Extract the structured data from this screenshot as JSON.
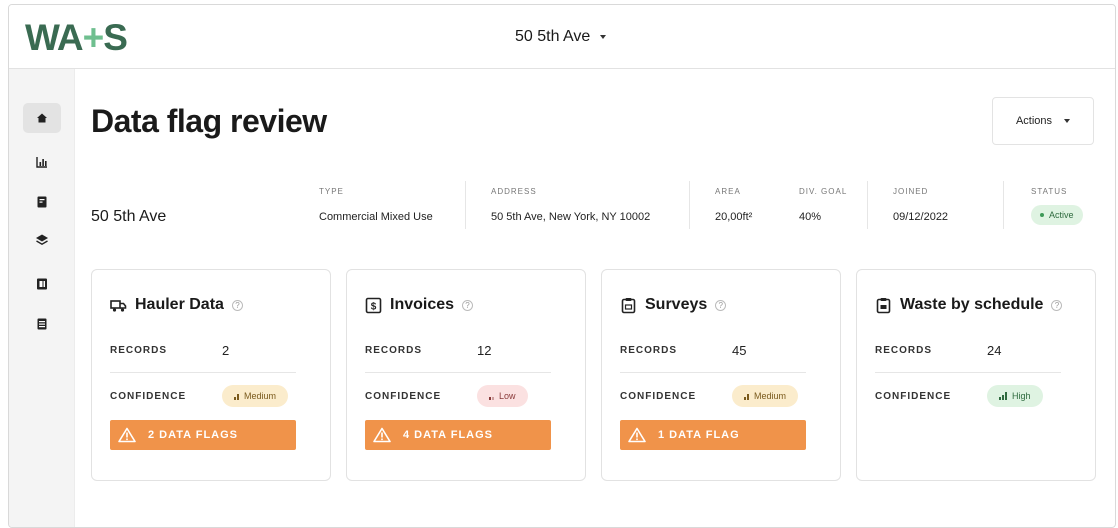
{
  "header": {
    "logo_left": "WA",
    "logo_plus": "+",
    "logo_right": "S",
    "site_selector": "50 5th Ave"
  },
  "sidebar": {
    "items": [
      {
        "icon": "home-icon",
        "active": true
      },
      {
        "icon": "chart-icon",
        "active": false
      },
      {
        "icon": "document-icon",
        "active": false
      },
      {
        "icon": "layers-icon",
        "active": false
      },
      {
        "icon": "billing-icon",
        "active": false
      },
      {
        "icon": "file-stack-icon",
        "active": false
      }
    ]
  },
  "page": {
    "title": "Data flag review",
    "actions_label": "Actions"
  },
  "site": {
    "name": "50 5th Ave",
    "meta": [
      {
        "label": "Type",
        "value": "Commercial Mixed Use"
      },
      {
        "label": "Address",
        "value": "50 5th Ave, New York, NY 10002"
      },
      {
        "label": "Area",
        "value": "20,00ft²"
      },
      {
        "label": "Div. goal",
        "value": "40%"
      },
      {
        "label": "Joined",
        "value": "09/12/2022"
      },
      {
        "label": "Status",
        "value": "Active"
      }
    ]
  },
  "cards": [
    {
      "title": "Hauler Data",
      "icon": "truck-icon",
      "records_label": "RECORDS",
      "records": "2",
      "confidence_label": "CONFIDENCE",
      "confidence": "Medium",
      "flags": "2 DATA FLAGS"
    },
    {
      "title": "Invoices",
      "icon": "invoice-icon",
      "records_label": "RECORDS",
      "records": "12",
      "confidence_label": "CONFIDENCE",
      "confidence": "Low",
      "flags": "4 DATA FLAGS"
    },
    {
      "title": "Surveys",
      "icon": "clipboard-icon",
      "records_label": "RECORDS",
      "records": "45",
      "confidence_label": "CONFIDENCE",
      "confidence": "Medium",
      "flags": "1 DATA FLAG"
    },
    {
      "title": "Waste by schedule",
      "icon": "schedule-icon",
      "records_label": "RECORDS",
      "records": "24",
      "confidence_label": "CONFIDENCE",
      "confidence": "High",
      "flags": ""
    }
  ],
  "colors": {
    "brand": "#3a6b52",
    "flag": "#f0934a",
    "status_active": "#dff3e2"
  }
}
